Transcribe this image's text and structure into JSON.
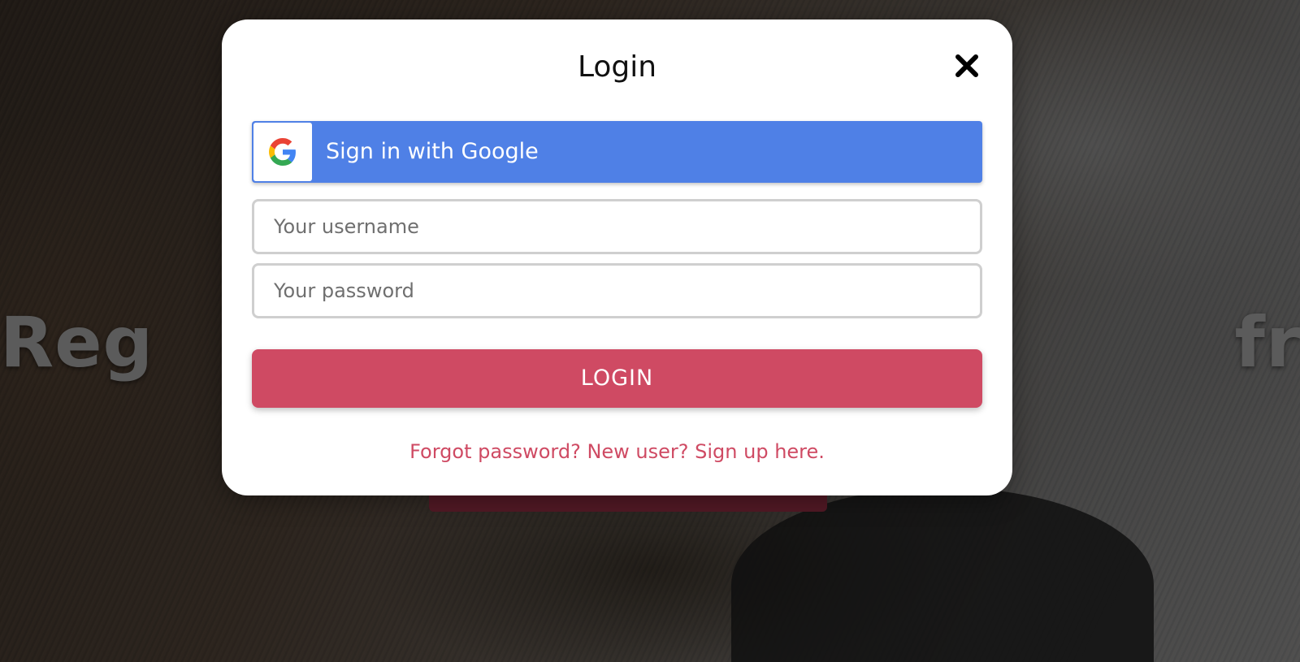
{
  "background": {
    "hero_text": "Reg                                           free"
  },
  "modal": {
    "title": "Login",
    "close_icon": "close-icon",
    "google": {
      "label": "Sign in with Google",
      "icon": "google-logo-icon",
      "color": "#4f80e6"
    },
    "username": {
      "placeholder": "Your username",
      "value": ""
    },
    "password": {
      "placeholder": "Your password",
      "value": ""
    },
    "login_label": "LOGIN",
    "login_color": "#cf4a63",
    "footer": {
      "forgot_password": "Forgot password?",
      "new_user": "New user? Sign up here."
    }
  }
}
